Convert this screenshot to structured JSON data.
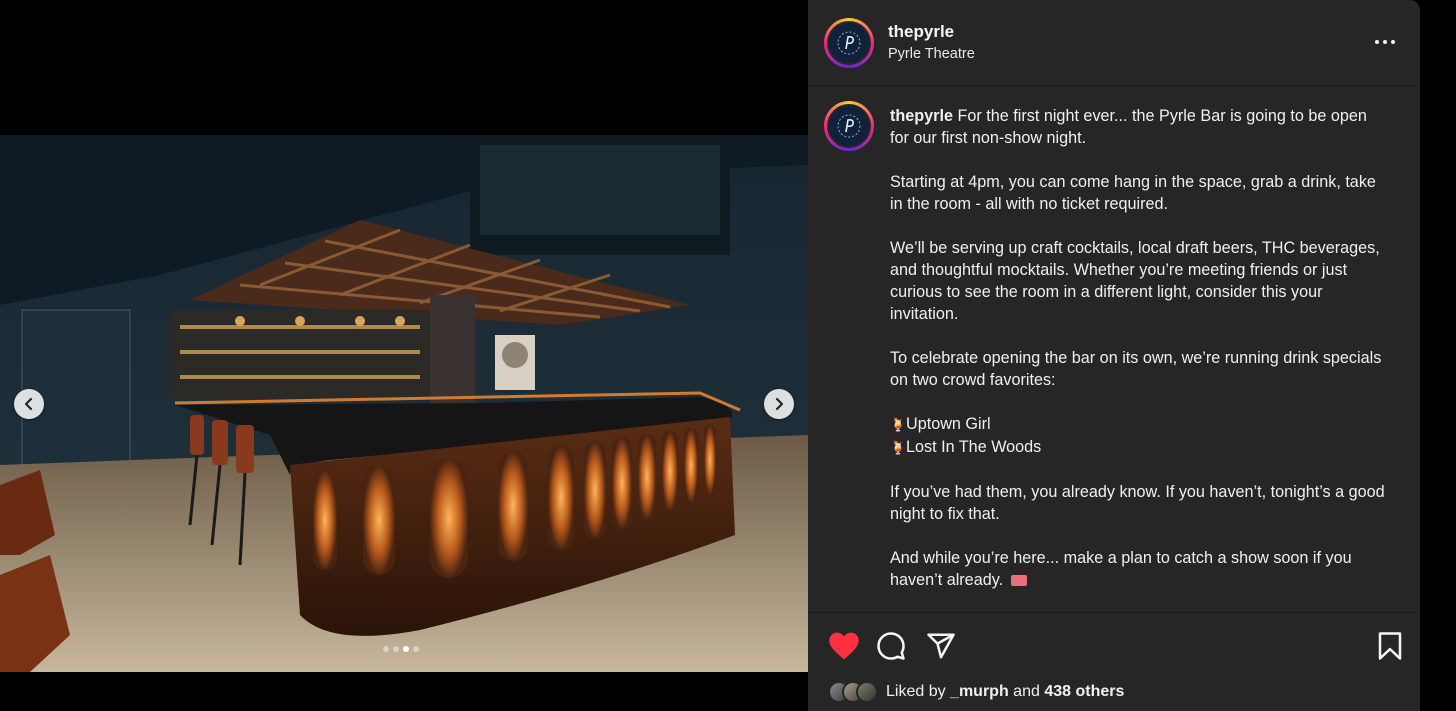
{
  "post": {
    "username": "thepyrle",
    "location": "Pyrle Theatre",
    "caption_username": "thepyrle",
    "caption_first": "For the first night ever... the Pyrle Bar is going to be open for our first non-show night.",
    "paragraph_2": "Starting at 4pm, you can come hang in the space, grab a drink, take in the room - all with no ticket required.",
    "paragraph_3": "We’ll be serving up craft cocktails, local draft beers, THC beverages, and thoughtful mocktails. Whether you’re meeting friends or just curious to see the room in a different light, consider this your invitation.",
    "paragraph_4": "To celebrate opening the bar on its own, we’re running drink specials on two crowd favorites:",
    "special_1": "Uptown Girl",
    "special_2": "Lost In The Woods",
    "paragraph_5": "If you’ve had them, you already know. If you haven’t, tonight’s a good night to fix that.",
    "paragraph_6": "And while you’re here... make a plan to catch a show soon if you haven’t already."
  },
  "carousel": {
    "slide_count": 4,
    "active_slide": 3
  },
  "likes": {
    "prefix": "Liked by",
    "user": "_murph",
    "joiner": "and",
    "others": "438 others"
  },
  "icons": {
    "more": "more-options-icon",
    "like": "heart-filled-icon",
    "comment": "comment-icon",
    "share": "paper-plane-icon",
    "save": "bookmark-icon",
    "prev": "chevron-left-icon",
    "next": "chevron-right-icon",
    "cocktail": "tropical-drink-emoji",
    "ticket": "ticket-emoji"
  },
  "colors": {
    "panel_bg": "#262626",
    "like_red": "#ff3040",
    "text": "#f5f5f5"
  }
}
